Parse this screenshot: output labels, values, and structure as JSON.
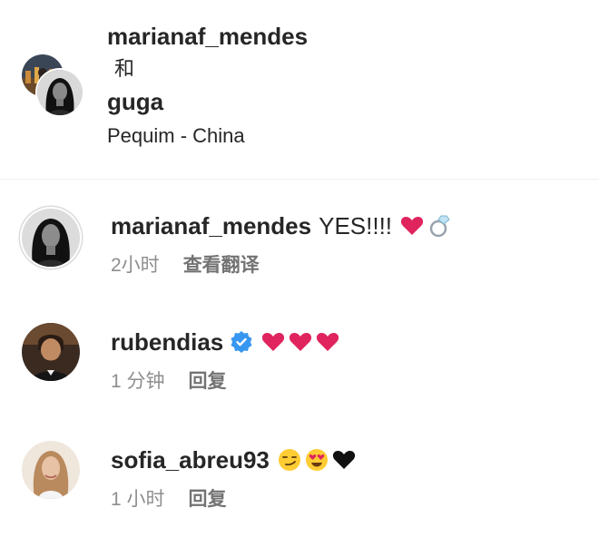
{
  "post_header": {
    "author": "marianaf_mendes",
    "conjunction": "和",
    "coauthor": "guga",
    "location": "Pequim - China"
  },
  "comments": [
    {
      "username": "marianaf_mendes",
      "text": "YES!!!!",
      "emojis": [
        "heart-emoji",
        "ring-emoji"
      ],
      "time": "2小时",
      "action": "查看翻译"
    },
    {
      "username": "rubendias",
      "verified": true,
      "emojis": [
        "heart-emoji",
        "heart-emoji",
        "heart-emoji"
      ],
      "time": "1 分钟",
      "action": "回复"
    },
    {
      "username": "sofia_abreu93",
      "emojis": [
        "smirk-emoji",
        "heart-eyes-emoji",
        "black-heart-emoji"
      ],
      "time": "1 小时",
      "action": "回复"
    }
  ],
  "colors": {
    "primary_text": "#262626",
    "secondary_text": "#8e8e8e",
    "verified_blue": "#3797f0",
    "heart_red": "#e0245e",
    "divider": "#efefef"
  }
}
